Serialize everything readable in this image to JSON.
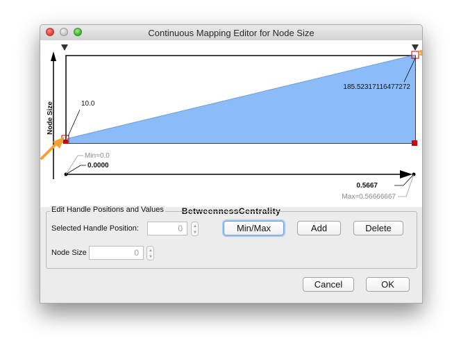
{
  "window": {
    "title": "Continuous Mapping Editor for Node Size"
  },
  "graph": {
    "y_label": "Node Size",
    "x_label": "BetweennessCentrality",
    "low_handle_value": "10.0",
    "high_handle_value": "185.52317116477272",
    "min_label": "Min=0.0",
    "min_value": "0.0000",
    "max_value": "0.5667",
    "max_label": "Max=0.56666667",
    "fill_color": "#8bbcf7",
    "handle_color": "#cc0000",
    "callout_color": "#f5a030"
  },
  "edit_panel": {
    "legend": "Edit Handle Positions and Values",
    "handle_position_label": "Selected Handle Position:",
    "handle_position_value": "0",
    "node_size_label": "Node Size",
    "node_size_value": "0"
  },
  "buttons": {
    "min_max": "Min/Max",
    "add": "Add",
    "delete": "Delete",
    "cancel": "Cancel",
    "ok": "OK"
  }
}
